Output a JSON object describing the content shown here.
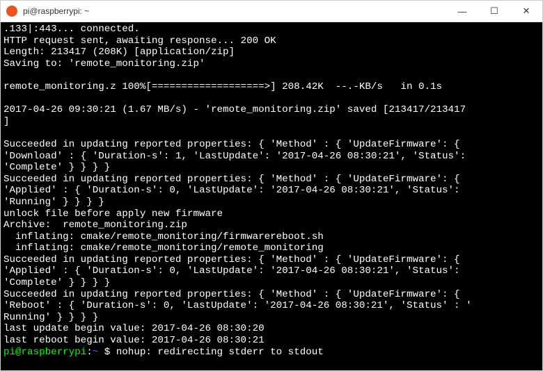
{
  "titlebar": {
    "title": "pi@raspberrypi: ~"
  },
  "win_controls": {
    "minimize": "—",
    "maximize": "☐",
    "close": "✕"
  },
  "terminal": {
    "lines": [
      ".133|:443... connected.",
      "HTTP request sent, awaiting response... 200 OK",
      "Length: 213417 (208K) [application/zip]",
      "Saving to: 'remote_monitoring.zip'",
      "",
      "remote_monitoring.z 100%[===================>] 208.42K  --.-KB/s   in 0.1s",
      "",
      "2017-04-26 09:30:21 (1.67 MB/s) - 'remote_monitoring.zip' saved [213417/213417",
      "]",
      "",
      "Succeeded in updating reported properties: { 'Method' : { 'UpdateFirmware': {",
      "'Download' : { 'Duration-s': 1, 'LastUpdate': '2017-04-26 08:30:21', 'Status':",
      "'Complete' } } } }",
      "Succeeded in updating reported properties: { 'Method' : { 'UpdateFirmware': {",
      "'Applied' : { 'Duration-s': 0, 'LastUpdate': '2017-04-26 08:30:21', 'Status':",
      "'Running' } } } }",
      "unlock file before apply new firmware",
      "Archive:  remote_monitoring.zip",
      "  inflating: cmake/remote_monitoring/firmwarereboot.sh",
      "  inflating: cmake/remote_monitoring/remote_monitoring",
      "Succeeded in updating reported properties: { 'Method' : { 'UpdateFirmware': {",
      "'Applied' : { 'Duration-s': 0, 'LastUpdate': '2017-04-26 08:30:21', 'Status':",
      "'Complete' } } } }",
      "Succeeded in updating reported properties: { 'Method' : { 'UpdateFirmware': {",
      "'Reboot' : { 'Duration-s': 0, 'LastUpdate': '2017-04-26 08:30:21', 'Status' : '",
      "Running' } } } }",
      "last update begin value: 2017-04-26 08:30:20",
      "last reboot begin value: 2017-04-26 08:30:21"
    ],
    "prompt_user_host": "pi@raspberrypi",
    "prompt_sep": ":",
    "prompt_path": "~ ",
    "prompt_dollar": "$ ",
    "prompt_tail": "nohup: redirecting stderr to stdout"
  }
}
